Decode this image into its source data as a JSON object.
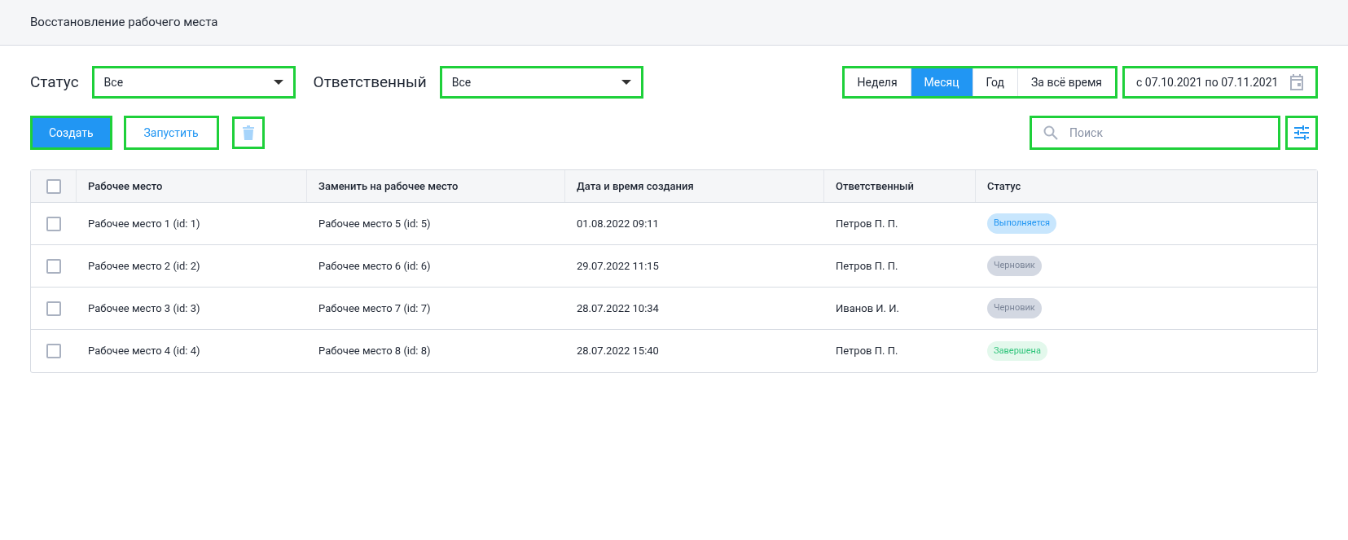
{
  "header": {
    "title": "Восстановление рабочего места"
  },
  "filters": [
    {
      "label": "Статус",
      "value": "Все"
    },
    {
      "label": "Ответственный",
      "value": "Все"
    }
  ],
  "periods": [
    {
      "label": "Неделя",
      "selected": false
    },
    {
      "label": "Месяц",
      "selected": true
    },
    {
      "label": "Год",
      "selected": false
    },
    {
      "label": "За всё время",
      "selected": false
    }
  ],
  "date_range": "с 07.10.2021 по 07.11.2021",
  "actions": {
    "create": "Создать",
    "run": "Запустить",
    "delete_disabled": true
  },
  "search": {
    "placeholder": "Поиск"
  },
  "table": {
    "all_checked": false,
    "columns": [
      "Рабочее место",
      "Заменить на рабочее место",
      "Дата и время создания",
      "Ответственный",
      "Статус"
    ],
    "rows": [
      {
        "checked": false,
        "cells": [
          "Рабочее место 1 (id: 1)",
          "Рабочее место 5 (id: 5)",
          "01.08.2022 09:11",
          "Петров П. П."
        ],
        "status": {
          "label": "Выполняется",
          "kind": "running"
        }
      },
      {
        "checked": false,
        "cells": [
          "Рабочее место 2 (id: 2)",
          "Рабочее место 6 (id: 6)",
          "29.07.2022 11:15",
          "Петров П. П."
        ],
        "status": {
          "label": "Черновик",
          "kind": "draft"
        }
      },
      {
        "checked": false,
        "cells": [
          "Рабочее место 3 (id: 3)",
          "Рабочее место 7 (id: 7)",
          "28.07.2022 10:34",
          "Иванов И. И."
        ],
        "status": {
          "label": "Черновик",
          "kind": "draft"
        }
      },
      {
        "checked": false,
        "cells": [
          "Рабочее место 4 (id: 4)",
          "Рабочее место 8 (id: 8)",
          "28.07.2022 15:40",
          "Петров П. П."
        ],
        "status": {
          "label": "Завершена",
          "kind": "done"
        }
      }
    ]
  }
}
